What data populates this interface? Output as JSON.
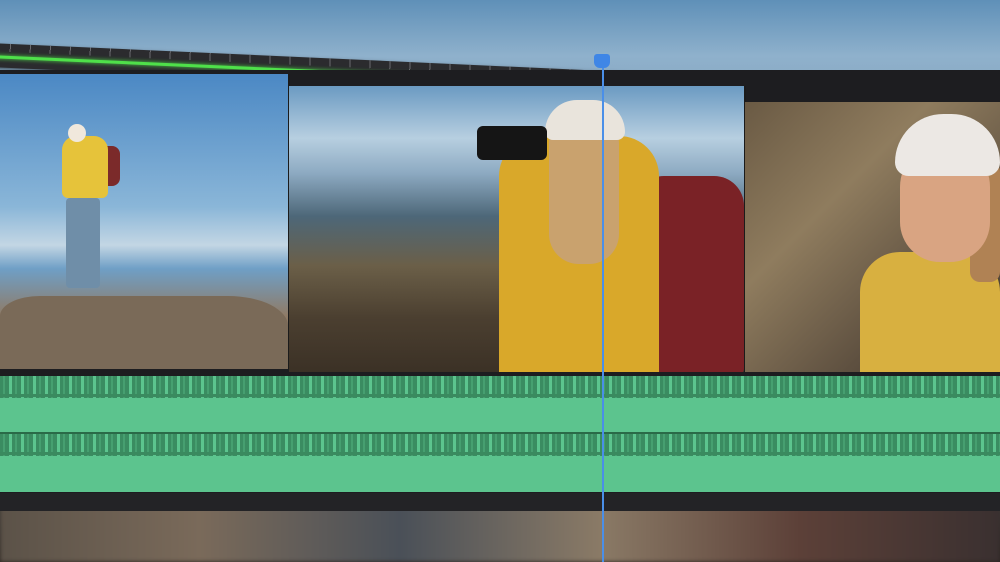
{
  "timeline": {
    "playhead_color": "#3f86e6",
    "work_area_color": "#4fe04a",
    "audio_color": "#5cc48e",
    "video_clips": [
      {
        "name": "hiker-on-rocks"
      },
      {
        "name": "photographer-with-camera"
      },
      {
        "name": "smiling-hiker"
      }
    ],
    "audio_lanes": 2
  }
}
